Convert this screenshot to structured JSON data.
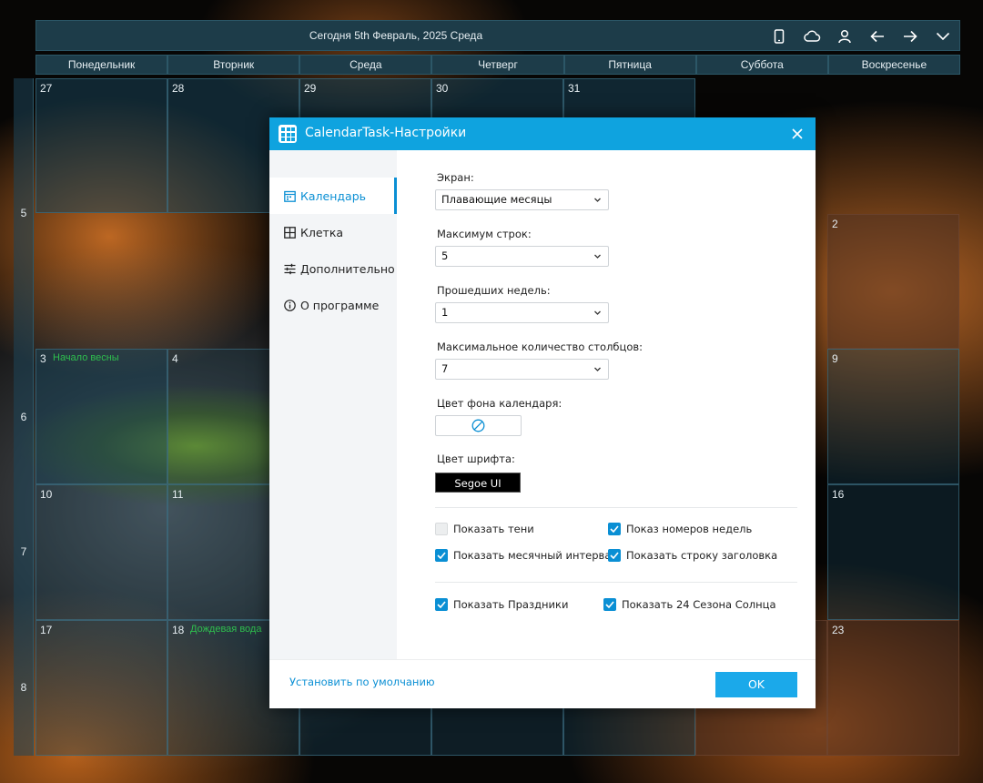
{
  "calendar": {
    "today_label": "Сегодня 5th Февраль, 2025 Среда",
    "toolbar_icons": [
      "phone-icon",
      "cloud-icon",
      "user-icon",
      "arrow-left-icon",
      "arrow-right-icon",
      "chevron-down-icon"
    ],
    "weekdays": [
      "Понедельник",
      "Вторник",
      "Среда",
      "Четверг",
      "Пятница",
      "Суббота",
      "Воскресенье"
    ],
    "week_numbers": [
      "5",
      "6",
      "7",
      "8"
    ],
    "cells": {
      "w5": [
        "27",
        "28",
        "29",
        "30",
        "31"
      ],
      "w5_sun": "2",
      "w6_mon": "3",
      "w6_mon_event": "Начало весны",
      "w6_tue": "4",
      "w6_sun": "9",
      "w7_mon": "10",
      "w7_tue": "11",
      "w7_sun": "16",
      "w8_mon": "17",
      "w8_tue": "18",
      "w8_tue_event": "Дождевая вода",
      "w8_sun": "23"
    }
  },
  "dialog": {
    "title": "CalendarTask-Настройки",
    "nav": [
      {
        "label": "Календарь",
        "icon": "calendar-icon",
        "active": true
      },
      {
        "label": "Клетка",
        "icon": "grid-icon",
        "active": false
      },
      {
        "label": "Дополнительно",
        "icon": "sliders-icon",
        "active": false
      },
      {
        "label": "О программе",
        "icon": "info-icon",
        "active": false
      }
    ],
    "screen_label": "Экран:",
    "screen_value": "Плавающие месяцы",
    "max_rows_label": "Максимум строк:",
    "max_rows_value": "5",
    "past_weeks_label": "Прошедших недель:",
    "past_weeks_value": "1",
    "max_cols_label": "Максимальное количество столбцов:",
    "max_cols_value": "7",
    "bg_color_label": "Цвет фона календаря:",
    "font_color_label": "Цвет шрифта:",
    "font_value": "Segoe UI",
    "checkboxes": [
      {
        "label": "Показать тени",
        "checked": false
      },
      {
        "label": "Показ номеров недель",
        "checked": true
      },
      {
        "label": "Показать месячный интервал",
        "checked": true
      },
      {
        "label": "Показать строку заголовка",
        "checked": true
      },
      {
        "label": "Показать Праздники",
        "checked": true
      },
      {
        "label": "Показать 24 Сезона Солнца",
        "checked": true
      }
    ],
    "reset_label": "Установить по умолчанию",
    "ok_label": "OK",
    "accent_color": "#0fa3df"
  }
}
